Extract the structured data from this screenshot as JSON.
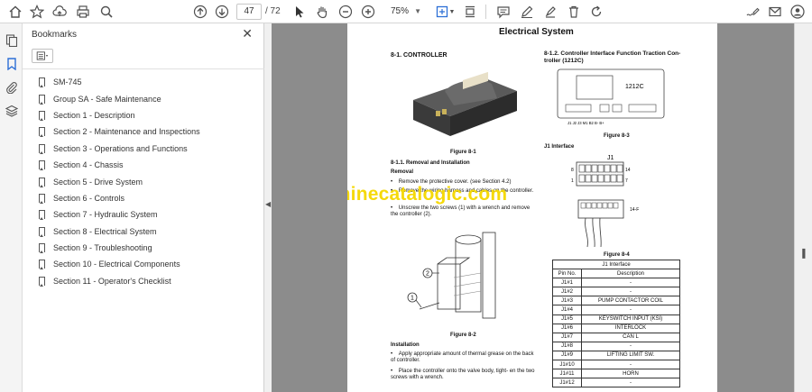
{
  "toolbar": {
    "page_current": "47",
    "page_total": "/ 72",
    "zoom": "75%"
  },
  "bookmarks_panel": {
    "title": "Bookmarks",
    "items": [
      "SM-745",
      "Group SA - Safe Maintenance",
      "Section 1 - Description",
      "Section 2 - Maintenance and Inspections",
      "Section 3 - Operations and Functions",
      "Section 4 - Chassis",
      "Section 5 - Drive System",
      "Section 6 - Controls",
      "Section 7 - Hydraulic System",
      "Section 8 - Electrical System",
      "Section 9 - Troubleshooting",
      "Section 10 - Electrical Components",
      "Section 11 - Operator's Checklist"
    ]
  },
  "document": {
    "title": "Electrical System",
    "left_heading": "8-1. CONTROLLER",
    "figure_8_1": "Figure 8-1",
    "subheading": "8-1.1. Removal and Installation",
    "removal": "Removal",
    "removal_steps": [
      "Remove the protective cover. (see Section 4.2)",
      "Remove the wiring harness and cables on the controller.",
      "Unscrew the two screws (1) with a wrench and remove the controller (2)."
    ],
    "figure_8_2": "Figure 8-2",
    "installation": "Installation",
    "installation_steps": [
      "Apply appropriate amount of thermal grease on the back of controller.",
      "Place the controller onto the valve body, tight- en the two screws with a wrench."
    ],
    "right_heading": "8-1.2. Controller Interface Function Traction Con- troller (1212C)",
    "controller_label": "1212C",
    "figure_8_3": "Figure 8-3",
    "j1_interface_label": "J1 Interface",
    "connector_label": "J1",
    "connector_pin_8": "8",
    "connector_pin_14": "14",
    "connector_pin_1": "1",
    "connector_pin_7": "7",
    "connector_side": "14-F",
    "figure_8_4": "Figure 8-4",
    "watermark": "machinecatalogic.com",
    "table": {
      "caption": "J1 Interface",
      "headers": [
        "Pin No.",
        "Description"
      ],
      "rows": [
        [
          "J1#1",
          "-"
        ],
        [
          "J1#2",
          "-"
        ],
        [
          "J1#3",
          "PUMP CONTACTOR COIL"
        ],
        [
          "J1#4",
          "-"
        ],
        [
          "J1#5",
          "KEYSWITCH INPUT (KSI)"
        ],
        [
          "J1#6",
          "INTERLOCK"
        ],
        [
          "J1#7",
          "CAN L"
        ],
        [
          "J1#8",
          "-"
        ],
        [
          "J1#9",
          "LIFTING LIMIT SW."
        ],
        [
          "J1#10",
          "-"
        ],
        [
          "J1#11",
          "HORN"
        ],
        [
          "J1#12",
          "-"
        ]
      ]
    },
    "callout_1": "1",
    "callout_2": "2",
    "terminal_labels": "J1 J2 J3 M1 B2 B- B+"
  }
}
